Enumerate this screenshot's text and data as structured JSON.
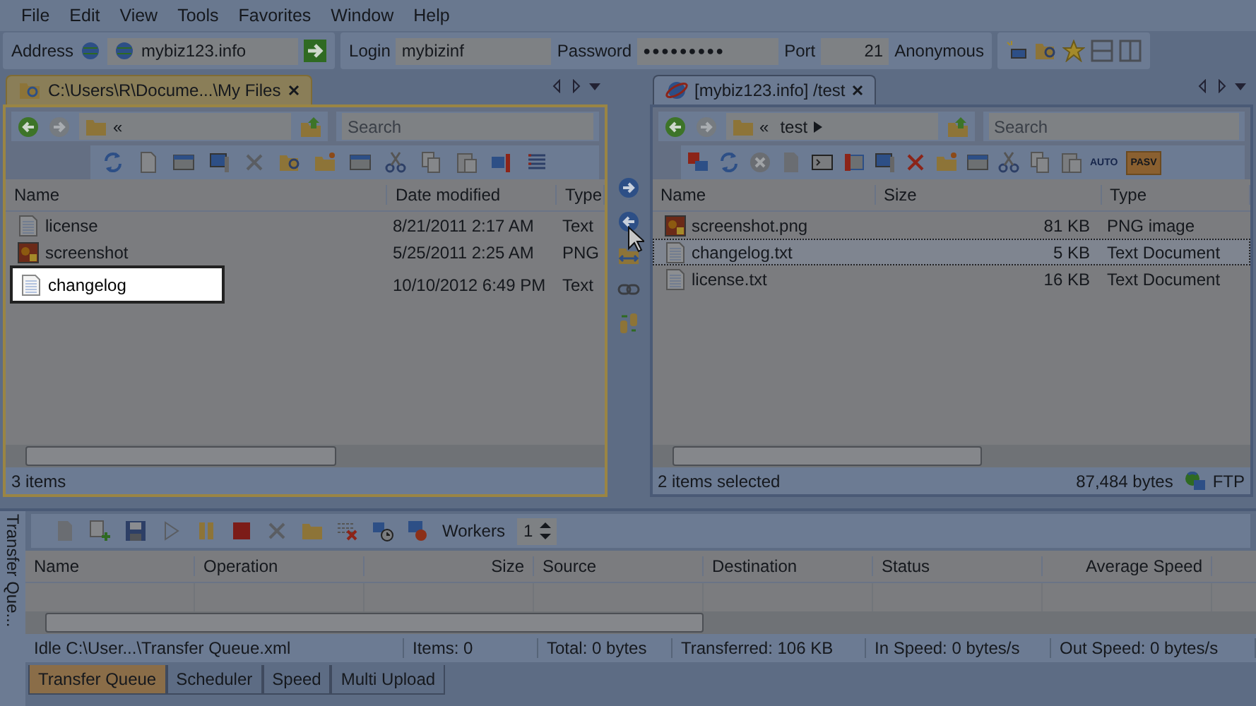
{
  "menu": [
    "File",
    "Edit",
    "View",
    "Tools",
    "Favorites",
    "Window",
    "Help"
  ],
  "connection": {
    "address_label": "Address",
    "address": "mybiz123.info",
    "login_label": "Login",
    "login": "mybizinf",
    "password_label": "Password",
    "password": "●●●●●●●●●",
    "port_label": "Port",
    "port": "21",
    "anonymous": "Anonymous"
  },
  "panes": [
    {
      "tab": "C:\\Users\\R\\Docume...\\My Files",
      "active": true,
      "path_prefix": "«",
      "search_placeholder": "Search",
      "columns": [
        "Name",
        "Date modified",
        "Type"
      ],
      "rows": [
        {
          "kind": "text",
          "cells": [
            "license",
            "8/21/2011 2:17 AM",
            "Text"
          ],
          "selected": false,
          "highlighted": false
        },
        {
          "kind": "image",
          "cells": [
            "screenshot",
            "5/25/2011 2:25 AM",
            "PNG"
          ],
          "selected": false,
          "highlighted": false
        },
        {
          "kind": "text",
          "cells": [
            "changelog",
            "10/10/2012 6:49 PM",
            "Text"
          ],
          "selected": false,
          "highlighted": true
        }
      ],
      "status": "3 items"
    },
    {
      "tab": "[mybiz123.info] /test",
      "active": false,
      "path_prefix": "«",
      "path": "test",
      "search_placeholder": "Search",
      "auto": "AUTO",
      "pasv": "PASV",
      "columns": [
        "Name",
        "Size",
        "Type"
      ],
      "rows": [
        {
          "kind": "image",
          "cells": [
            "screenshot.png",
            "81 KB",
            "PNG image"
          ],
          "selected": false,
          "highlighted": false
        },
        {
          "kind": "text",
          "cells": [
            "changelog.txt",
            "5 KB",
            "Text Document"
          ],
          "selected": true,
          "highlighted": false
        },
        {
          "kind": "text",
          "cells": [
            "license.txt",
            "16 KB",
            "Text Document"
          ],
          "selected": false,
          "highlighted": false
        }
      ],
      "status": "2 items selected",
      "bytes": "87,484  bytes",
      "protocol": "FTP"
    }
  ],
  "queue": {
    "side_tab": "Transfer Que...",
    "workers_label": "Workers",
    "workers": "1",
    "columns": [
      "Name",
      "Operation",
      "Size",
      "Source",
      "Destination",
      "Status",
      "Average Speed"
    ],
    "status": [
      "Idle   C:\\User...\\Transfer Queue.xml",
      "Items: 0",
      "Total: 0 bytes",
      "Transferred: 106 KB",
      "In Speed: 0 bytes/s",
      "Out Speed: 0 bytes/s"
    ]
  },
  "bottom_tabs": [
    {
      "label": "Transfer Queue",
      "selected": true
    },
    {
      "label": "Scheduler",
      "selected": false
    },
    {
      "label": "Speed",
      "selected": false
    },
    {
      "label": "Multi Upload",
      "selected": false
    }
  ]
}
